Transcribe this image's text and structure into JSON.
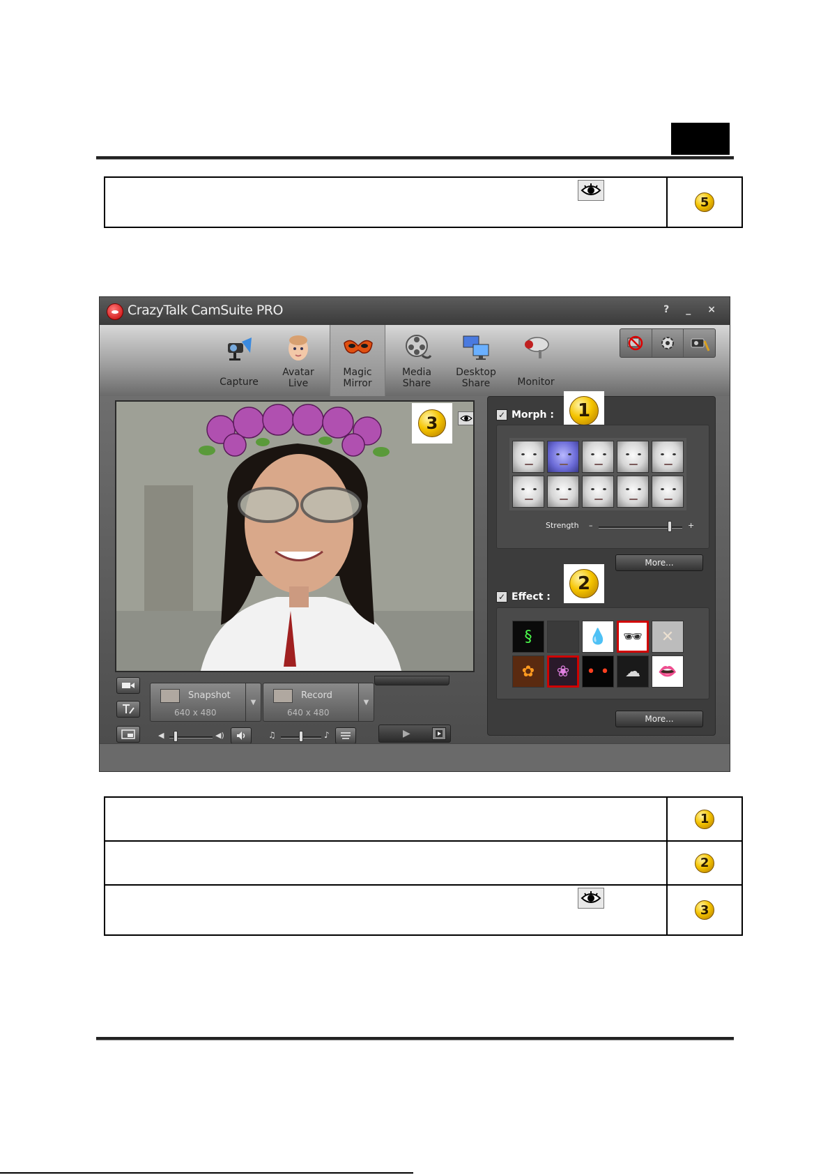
{
  "doc": {
    "top_table": {
      "badge": "5"
    },
    "bottom_table": [
      {
        "badge": "1",
        "has_eye": false
      },
      {
        "badge": "2",
        "has_eye": false
      },
      {
        "badge": "3",
        "has_eye": true
      }
    ],
    "icons": {
      "eye": "eye-icon"
    }
  },
  "app": {
    "title": "CrazyTalk CamSuite PRO",
    "window_controls": [
      "?",
      "_",
      "×"
    ],
    "nav": [
      {
        "line1": "Capture",
        "line2": "",
        "icon": "camera-icon",
        "active": false
      },
      {
        "line1": "Avatar",
        "line2": "Live",
        "icon": "baby-face-icon",
        "active": false
      },
      {
        "line1": "Magic",
        "line2": "Mirror",
        "icon": "mask-icon",
        "active": true
      },
      {
        "line1": "Media",
        "line2": "Share",
        "icon": "film-reel-icon",
        "active": false
      },
      {
        "line1": "Desktop",
        "line2": "Share",
        "icon": "monitors-icon",
        "active": false
      },
      {
        "line1": "Monitor",
        "line2": "",
        "icon": "security-camera-icon",
        "active": false
      }
    ],
    "tools": [
      "no-webcam-icon",
      "gear-icon",
      "camera-settings-icon"
    ],
    "video": {
      "badge": "3"
    },
    "snapshot": {
      "label": "Snapshot",
      "resolution": "640 x 480"
    },
    "record": {
      "label": "Record",
      "resolution": "640 x 480"
    },
    "morph": {
      "checked": true,
      "title": "Morph :",
      "badge": "1",
      "selected_index": 1,
      "count": 10,
      "strength_label": "Strength",
      "strength_minus": "–",
      "strength_plus": "+",
      "strength_level": 0.85,
      "more": "More..."
    },
    "effect": {
      "checked": true,
      "title": "Effect :",
      "badge": "2",
      "items": [
        {
          "icon": "green-swirl-icon",
          "bg": "#0a0a0a",
          "glyph": "§",
          "color": "#4cff4c"
        },
        {
          "icon": "noise-texture-icon",
          "bg": "#3a3a3a",
          "glyph": "",
          "color": "#777777"
        },
        {
          "icon": "water-drop-icon",
          "bg": "#ffffff",
          "glyph": "💧",
          "color": "#3a8adf"
        },
        {
          "icon": "sunglasses-icon",
          "bg": "#ffffff",
          "glyph": "🕶",
          "color": "#2a2a2a"
        },
        {
          "icon": "bandage-icon",
          "bg": "#bcbcbc",
          "glyph": "✕",
          "color": "#ece0d0"
        },
        {
          "icon": "butterfly-mask-icon",
          "bg": "#5a2a10",
          "glyph": "✿",
          "color": "#ff9a20"
        },
        {
          "icon": "flower-crown-icon",
          "bg": "#2a1a2a",
          "glyph": "❀",
          "color": "#e080e0"
        },
        {
          "icon": "glowing-eyes-icon",
          "bg": "#050505",
          "glyph": "• •",
          "color": "#ff4020"
        },
        {
          "icon": "smoke-face-icon",
          "bg": "#1a1a1a",
          "glyph": "☁",
          "color": "#d8d8d8"
        },
        {
          "icon": "red-lips-icon",
          "bg": "#ffffff",
          "glyph": "👄",
          "color": "#e01030"
        }
      ],
      "selected_indices": [
        3,
        6
      ],
      "more": "More..."
    },
    "volume_level": 0.15,
    "mic_level": 0.5
  }
}
